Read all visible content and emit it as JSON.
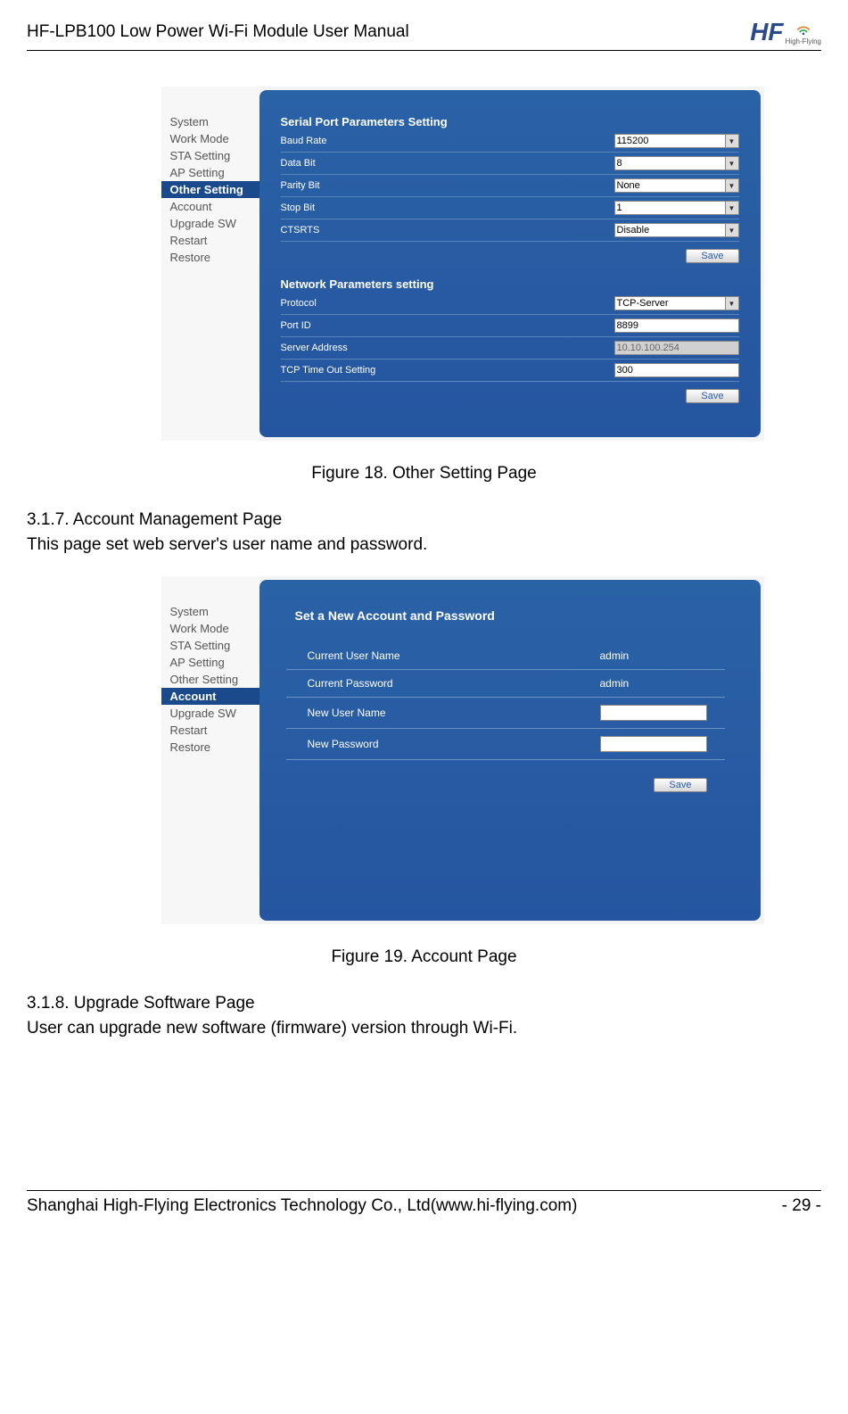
{
  "header": {
    "title": "HF-LPB100 Low Power Wi-Fi Module User Manual",
    "logoText": "HF",
    "logoSub": "High-Flying"
  },
  "figure18": {
    "sidebar": [
      "System",
      "Work Mode",
      "STA Setting",
      "AP Setting",
      "Other Setting",
      "Account",
      "Upgrade SW",
      "Restart",
      "Restore"
    ],
    "activeIndex": 4,
    "serial": {
      "title": "Serial Port Parameters Setting",
      "rows": [
        {
          "label": "Baud Rate",
          "value": "115200",
          "type": "dropdown"
        },
        {
          "label": "Data Bit",
          "value": "8",
          "type": "dropdown"
        },
        {
          "label": "Parity Bit",
          "value": "None",
          "type": "dropdown"
        },
        {
          "label": "Stop Bit",
          "value": "1",
          "type": "dropdown"
        },
        {
          "label": "CTSRTS",
          "value": "Disable",
          "type": "dropdown"
        }
      ],
      "save": "Save"
    },
    "network": {
      "title": "Network Parameters setting",
      "rows": [
        {
          "label": "Protocol",
          "value": "TCP-Server",
          "type": "dropdown"
        },
        {
          "label": "Port ID",
          "value": "8899",
          "type": "text"
        },
        {
          "label": "Server Address",
          "value": "10.10.100.254",
          "type": "text-disabled"
        },
        {
          "label": "TCP Time Out Setting",
          "value": "300",
          "type": "text"
        }
      ],
      "save": "Save"
    },
    "caption": "Figure 18.   Other Setting Page"
  },
  "section317": {
    "heading": "3.1.7.    Account Management Page",
    "body": "This page set web server's user name and password."
  },
  "figure19": {
    "sidebar": [
      "System",
      "Work Mode",
      "STA Setting",
      "AP Setting",
      "Other Setting",
      "Account",
      "Upgrade SW",
      "Restart",
      "Restore"
    ],
    "activeIndex": 5,
    "title": "Set a New Account and Password",
    "rows": [
      {
        "label": "Current User Name",
        "value": "admin",
        "type": "static"
      },
      {
        "label": "Current Password",
        "value": "admin",
        "type": "static"
      },
      {
        "label": "New User Name",
        "value": "",
        "type": "input"
      },
      {
        "label": "New Password",
        "value": "",
        "type": "input"
      }
    ],
    "save": "Save",
    "caption": "Figure 19.   Account Page"
  },
  "section318": {
    "heading": "3.1.8.    Upgrade Software Page",
    "body": "User can upgrade new software (firmware) version through Wi-Fi."
  },
  "footer": {
    "left": "Shanghai High-Flying Electronics Technology Co., Ltd(www.hi-flying.com)",
    "right": "- 29 -"
  }
}
